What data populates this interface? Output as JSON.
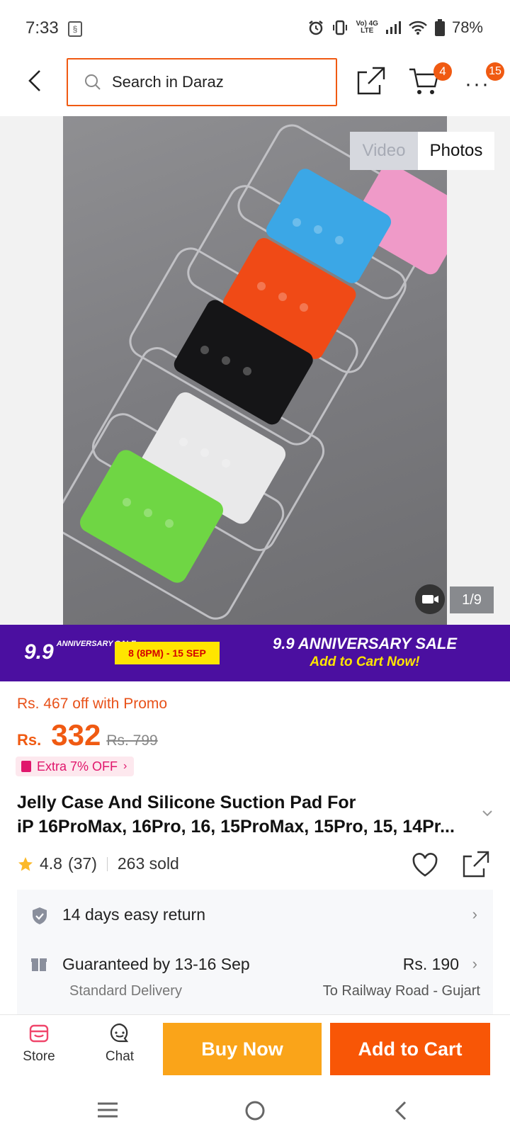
{
  "status": {
    "time": "7:33",
    "battery": "78%",
    "net_top": "Vo) 4G",
    "net_bottom": "LTE"
  },
  "nav": {
    "search_placeholder": "Search in Daraz",
    "cart_count": "4",
    "more_count": "15"
  },
  "media": {
    "tab_video": "Video",
    "tab_photos": "Photos",
    "pager": "1/9"
  },
  "banner": {
    "logo": "9.9",
    "logo_small": "ANNIVERSARY SALE",
    "dates": "8 (8PM) - 15 SEP",
    "title": "9.9 ANNIVERSARY SALE",
    "subtitle": "Add to Cart Now!"
  },
  "price": {
    "promo": "Rs. 467 off with Promo",
    "currency": "Rs.",
    "value": "332",
    "original": "Rs. 799",
    "extra": "Extra 7% OFF"
  },
  "product": {
    "title_line1": "Jelly Case And Silicone Suction Pad For",
    "title_line2": "iP 16ProMax, 16Pro, 16, 15ProMax, 15Pro, 15, 14Pr...",
    "rating": "4.8",
    "reviews": "(37)",
    "sold": "263 sold"
  },
  "service": {
    "return_text": "14 days easy return",
    "delivery_text": "Guaranteed by 13-16 Sep",
    "delivery_price": "Rs. 190",
    "delivery_type": "Standard Delivery",
    "delivery_location": "To Railway Road - Gujart"
  },
  "actions": {
    "store": "Store",
    "chat": "Chat",
    "buy_now": "Buy Now",
    "add_to_cart": "Add to Cart"
  },
  "colors": {
    "brand_orange": "#f85606",
    "buy_now_yellow": "#faa419",
    "banner_purple": "#4b0fa0"
  }
}
